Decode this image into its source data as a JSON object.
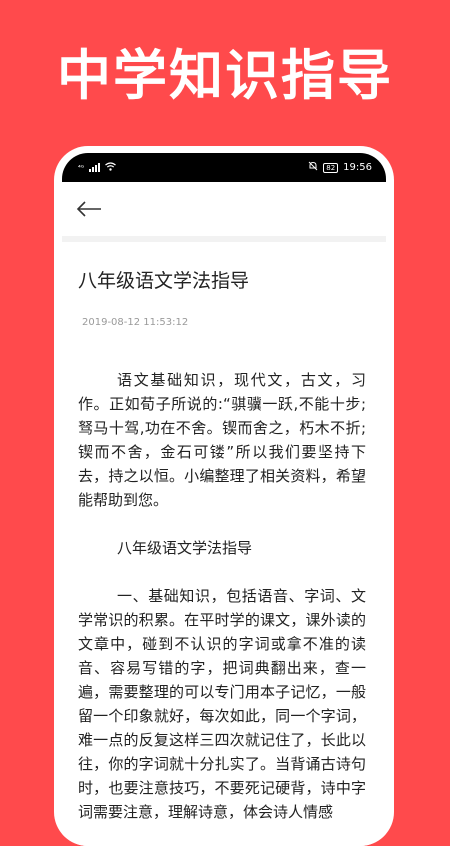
{
  "banner": {
    "title": "中学知识指导"
  },
  "status_bar": {
    "signal": "⁴ᴳ",
    "battery": "82",
    "time": "19:56"
  },
  "appbar": {
    "back_icon": "arrow-left-icon"
  },
  "article": {
    "title": "八年级语文学法指导",
    "date": "2019-08-12 11:53:12",
    "paragraphs": [
      "语文基础知识，现代文，古文，习作。正如荀子所说的:“骐骥一跃,不能十步;驽马十驾,功在不舍。锲而舍之，朽木不折;锲而不舍，金石可镂”所以我们要坚持下去，持之以恒。小编整理了相关资料，希望能帮助到您。",
      "八年级语文学法指导",
      "一、基础知识，包括语音、字词、文学常识的积累。在平时学的课文，课外读的文章中，碰到不认识的字词或拿不准的读音、容易写错的字，把词典翻出来，查一遍，需要整理的可以专门用本子记忆，一般留一个印象就好，每次如此，同一个字词，难一点的反复这样三四次就记住了，长此以往，你的字词就十分扎实了。当背诵古诗句时，也要注意技巧，不要死记硬背，诗中字词需要注意，理解诗意，体会诗人情感"
    ]
  },
  "colors": {
    "background": "#FF4A4C",
    "frame": "#FFFFFF",
    "status_bar": "#000000"
  }
}
